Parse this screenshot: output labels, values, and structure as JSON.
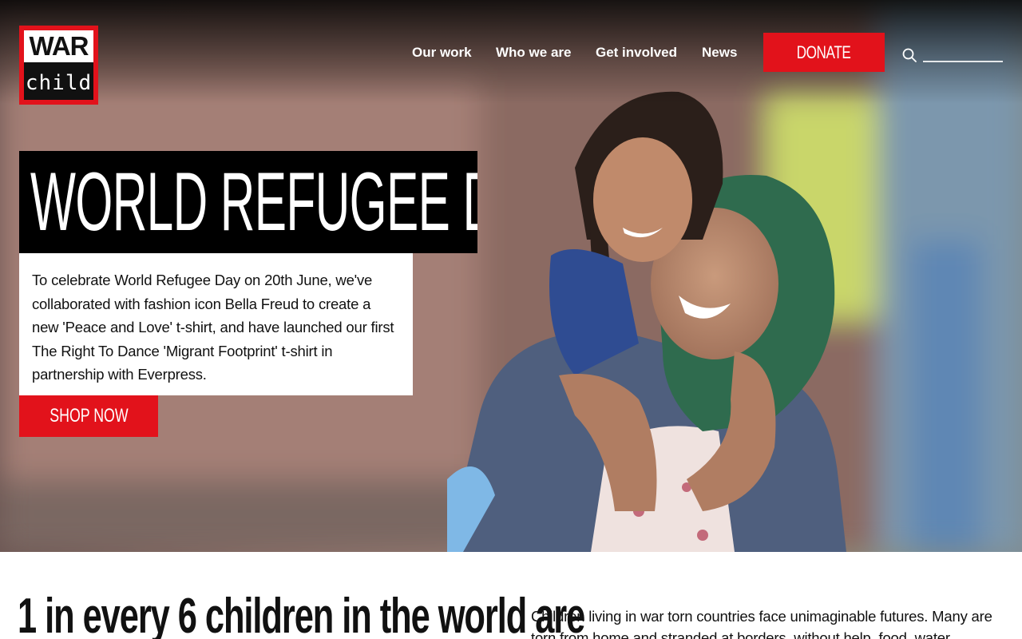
{
  "logo": {
    "line1": "WAR",
    "line2": "child"
  },
  "nav": {
    "items": [
      {
        "label": "Our work"
      },
      {
        "label": "Who we are"
      },
      {
        "label": "Get involved"
      },
      {
        "label": "News"
      }
    ],
    "donate_label": "DONATE",
    "search_placeholder": ""
  },
  "hero": {
    "headline": "WORLD REFUGEE DAY",
    "description": "To celebrate World Refugee Day on 20th June, we've collaborated with fashion icon Bella Freud to create a new 'Peace and Love' t-shirt, and have launched our first The Right To Dance 'Migrant Footprint' t-shirt in partnership with Everpress.",
    "cta_label": "SHOP NOW"
  },
  "section": {
    "stat_heading": "1 in every 6 children in the world are",
    "intro_text": "Children living in war torn countries face unimaginable futures. Many are torn from home and stranded at borders, without help, food, water"
  },
  "colors": {
    "brand_red": "#e2121b",
    "black": "#000000"
  }
}
